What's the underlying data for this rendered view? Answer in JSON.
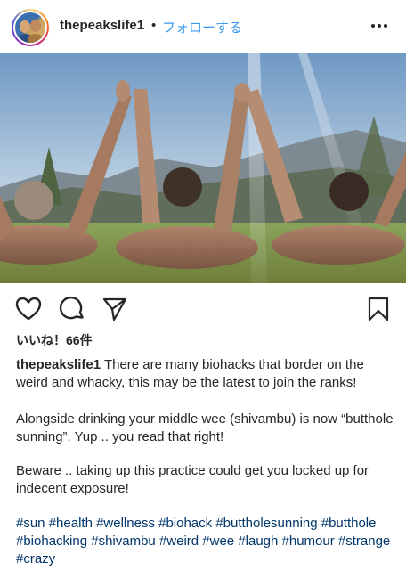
{
  "header": {
    "username": "thepeakslife1",
    "separator": "•",
    "follow_label": "フォローする",
    "more_icon": "more-horizontal-icon"
  },
  "actions": {
    "like_icon": "heart-icon",
    "comment_icon": "comment-icon",
    "share_icon": "paper-plane-icon",
    "save_icon": "bookmark-icon"
  },
  "likes": "いいね！66件",
  "caption": {
    "username": "thepeakslife1",
    "p1": "There are many biohacks that border on the weird and whacky, this may be the latest to join the ranks!",
    "p2": "Alongside drinking your middle wee (shivambu) is now “butthole sunning”. Yup .. you read that right!",
    "p3": "Beware .. taking up this practice could get you locked up for indecent exposure!",
    "hashtags": "#sun #health #wellness #biohack #buttholesunning #butthole #biohacking #shivambu #weird #wee #laugh #humour #strange #crazy"
  },
  "colors": {
    "link_blue": "#3897f0",
    "hashtag_blue": "#003569",
    "text": "#262626"
  }
}
